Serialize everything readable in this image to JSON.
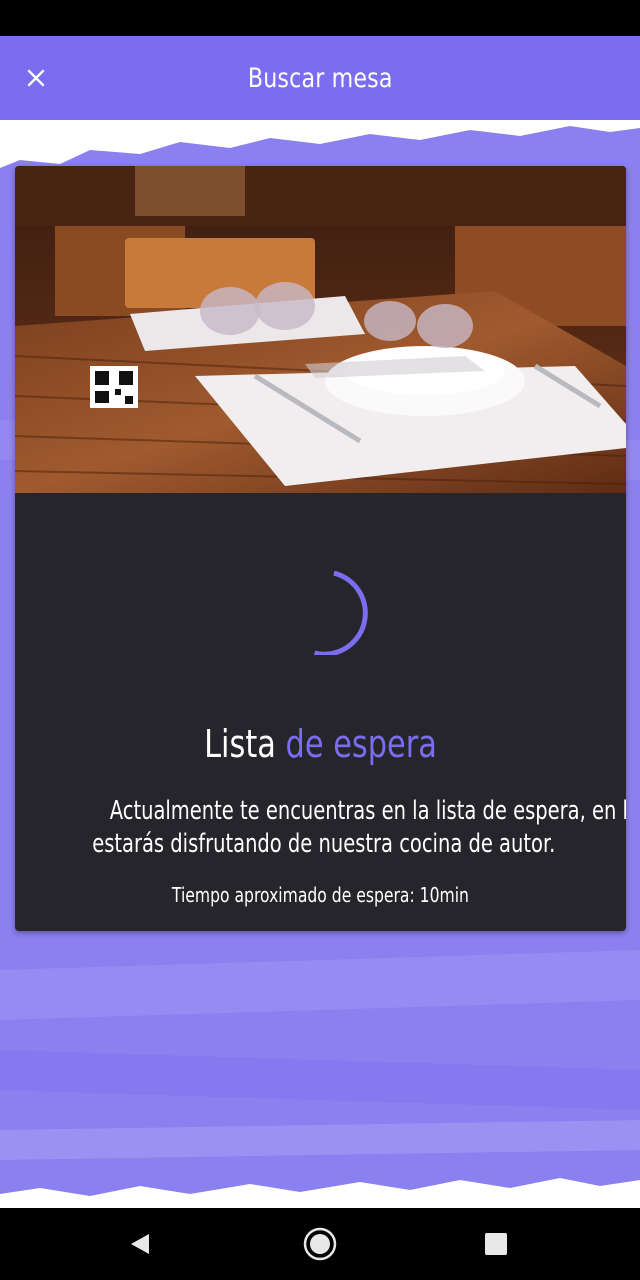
{
  "app_bar": {
    "title": "Buscar mesa",
    "close_icon": "close-icon",
    "color": "#7b6df0"
  },
  "card": {
    "image": "restaurant-table-photo",
    "spinner": "loading-spinner",
    "heading_part1": "Lista ",
    "heading_part2": "de espera",
    "message_line1": "Actualmente te encuentras en la lista de espera, en breve",
    "message_line2": "estarás disfrutando de nuestra cocina de autor.",
    "wait_text": "Tiempo aproximado de espera: 10min",
    "background": "#26252b",
    "accent": "#7b6df0"
  },
  "nav_bar": {
    "back_icon": "back-triangle-icon",
    "home_icon": "home-circle-icon",
    "recents_icon": "recents-square-icon"
  }
}
